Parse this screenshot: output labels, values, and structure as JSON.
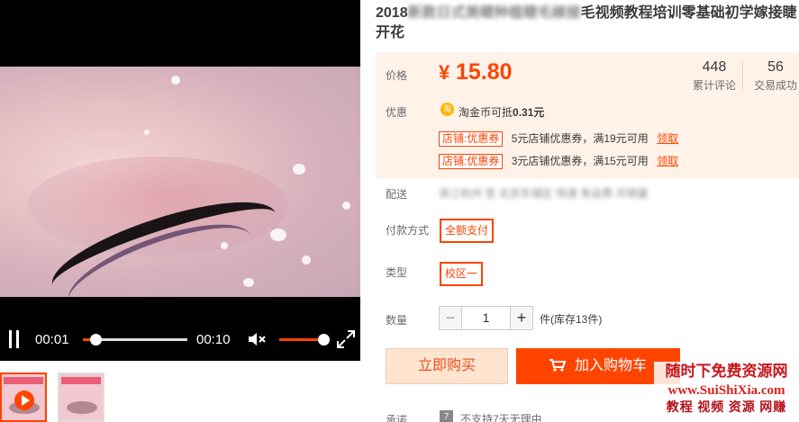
{
  "video": {
    "current_time": "00:01",
    "duration": "00:10",
    "progress_fraction": 0.12,
    "volume_fraction": 0.95
  },
  "thumbnails": [
    {
      "active": true
    },
    {
      "active": false
    }
  ],
  "product": {
    "title_prefix": "2018",
    "title_blurred": "新款日式美睫种植睫毛嫁接",
    "title_suffix": "毛视频教程培训零基础初学嫁接睫开花",
    "price_label": "价格",
    "currency": "¥",
    "price": "15.80",
    "reviews_count": "448",
    "reviews_label": "累计评论",
    "sales_count": "56",
    "sales_label": "交易成功",
    "promo_label": "优惠",
    "coin_icon_char": "淘",
    "coin_text": "淘金币可抵",
    "coin_amount": "0.31元",
    "coupons": [
      {
        "tag": "店铺:优惠券",
        "text": "5元店铺优惠券，满19元可用",
        "action": "领取"
      },
      {
        "tag": "店铺:优惠券",
        "text": "3元店铺优惠券，满15元可用",
        "action": "领取"
      }
    ],
    "shipping_label": "配送",
    "shipping_blurred": "浙江杭州 至 北京东城区 快递 免运费 月销量",
    "payment_label": "付款方式",
    "payment_option": "全额支付",
    "type_label": "类型",
    "type_option": "校区一",
    "quantity_label": "数量",
    "quantity": "1",
    "qty_minus": "−",
    "qty_plus": "+",
    "stock_text": "件(库存13件)",
    "buy_now_label": "立即购买",
    "add_cart_label": "加入购物车",
    "commit_label": "承诺",
    "commit_icon_char": "7",
    "commit_text": "不支持7天无理由"
  },
  "watermark": {
    "line1": "随时下免费资源网",
    "line2": "www.SuiShiXia.com",
    "line3": "教程 视频 资源 网赚"
  },
  "colors": {
    "accent": "#ff4400",
    "price_bg": "#fff2e8"
  }
}
